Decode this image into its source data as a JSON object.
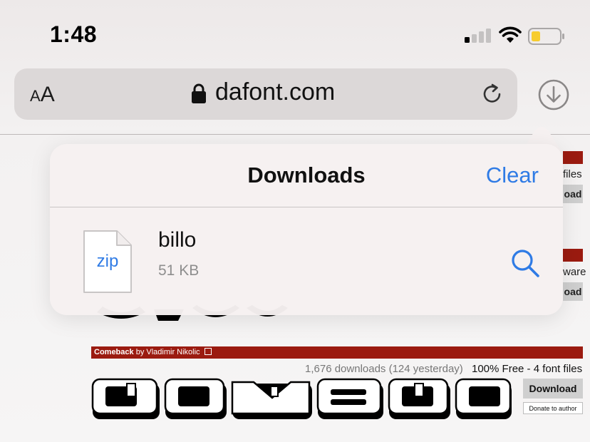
{
  "status_bar": {
    "time": "1:48"
  },
  "url_bar": {
    "text_size_label": "AA",
    "url": "dafont.com"
  },
  "background_page": {
    "partial_row1_text": "files",
    "partial_row1_button": "oad",
    "partial_row2_text": "ware",
    "partial_row2_button": "oad",
    "font_name": "Comeback",
    "font_author": "by Vladimir Nikolic",
    "downloads_count": "1,676 downloads (124 yesterday)",
    "license": "100% Free - 4 font files",
    "download_button": "Download",
    "donate_button": "Donate to author",
    "accent_color": "#9b1b10"
  },
  "downloads_popover": {
    "title": "Downloads",
    "clear_label": "Clear",
    "items": [
      {
        "file_type": "zip",
        "name": "billo",
        "size": "51 KB"
      }
    ],
    "link_color": "#2f7be5"
  }
}
